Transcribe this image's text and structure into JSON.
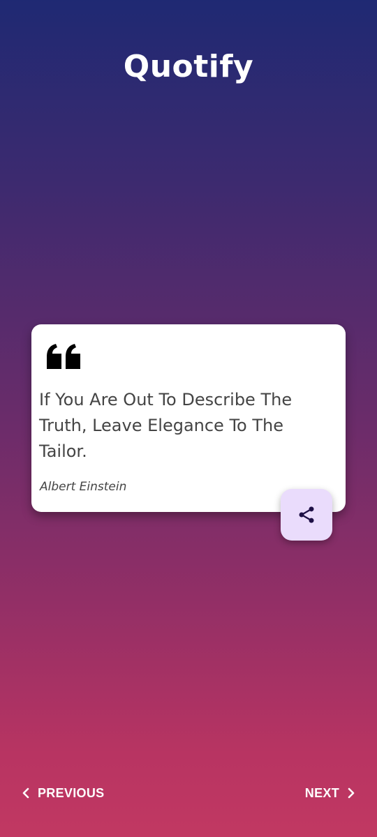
{
  "app": {
    "title": "Quotify"
  },
  "quote": {
    "text": "If You Are Out To Describe The Truth, Leave Elegance To The Tailor.",
    "author": "Albert Einstein",
    "icon": "quote-open-icon"
  },
  "actions": {
    "share_icon": "share-icon"
  },
  "navigation": {
    "previous_label": "PREVIOUS",
    "next_label": "NEXT",
    "previous_icon": "chevron-left-icon",
    "next_icon": "chevron-right-icon"
  },
  "colors": {
    "gradient_top": "#1f2973",
    "gradient_bottom": "#c13862",
    "card_background": "#ffffff",
    "share_button_background": "#eadcfc",
    "share_icon_color": "#1e1046"
  }
}
